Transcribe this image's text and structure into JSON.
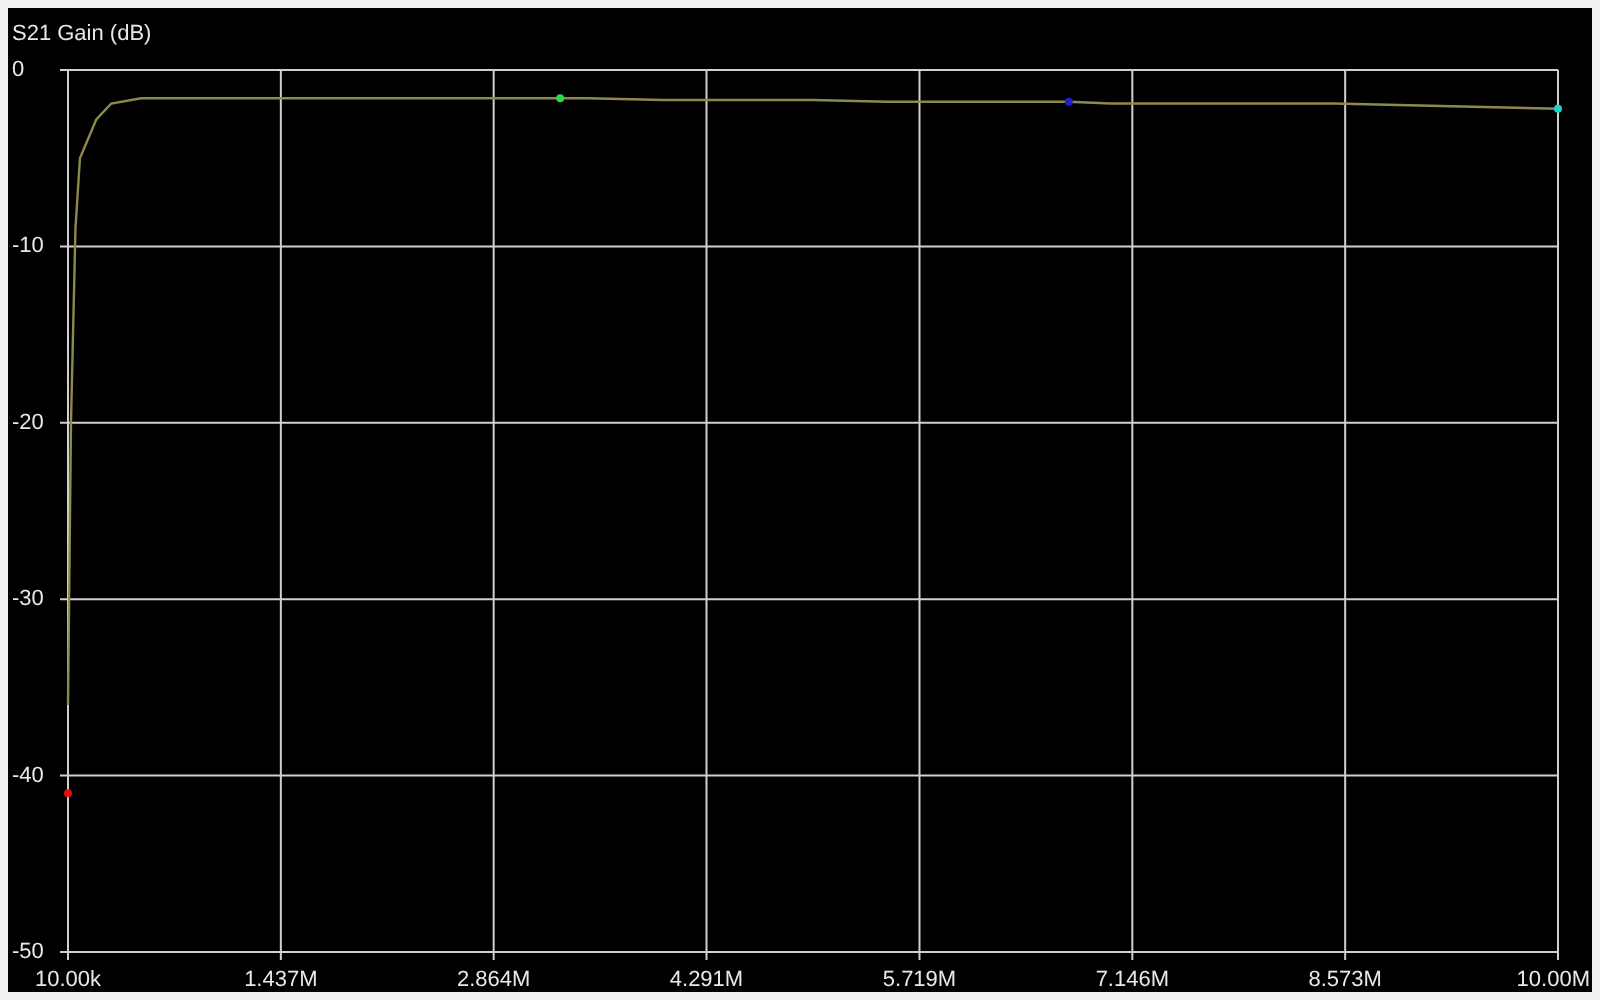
{
  "chart_data": {
    "type": "line",
    "title": "S21 Gain (dB)",
    "grid": true,
    "x": [
      10000,
      30000,
      60000,
      90000,
      200000,
      300000,
      500000,
      1000000,
      1500000,
      2000000,
      2500000,
      3000000,
      3310000,
      3500000,
      4000000,
      4500000,
      5000000,
      5500000,
      6000000,
      6500000,
      6720000,
      7000000,
      7500000,
      8000000,
      8500000,
      9000000,
      9500000,
      10000000
    ],
    "series": [
      {
        "color": "#8f8a4a",
        "values": [
          -36,
          -20,
          -9,
          -5,
          -2.8,
          -1.9,
          -1.6,
          -1.6,
          -1.6,
          -1.6,
          -1.6,
          -1.6,
          -1.6,
          -1.6,
          -1.7,
          -1.7,
          -1.7,
          -1.8,
          -1.8,
          -1.8,
          -1.8,
          -1.9,
          -1.9,
          -1.9,
          -1.9,
          -2,
          -2.1,
          -2.2
        ]
      },
      {
        "marker": "dot",
        "color": "#e01010",
        "values": [
          -41,
          null,
          null,
          null,
          null,
          null,
          null,
          null,
          null,
          null,
          null,
          null,
          null,
          null,
          null,
          null,
          null,
          null,
          null,
          null,
          null,
          null,
          null,
          null,
          null,
          null,
          null,
          null
        ]
      },
      {
        "marker": "dot",
        "color": "#20e040",
        "values": [
          null,
          null,
          null,
          null,
          null,
          null,
          null,
          null,
          null,
          null,
          null,
          null,
          -1.6,
          null,
          null,
          null,
          null,
          null,
          null,
          null,
          null,
          null,
          null,
          null,
          null,
          null,
          null,
          null
        ]
      },
      {
        "marker": "dot",
        "color": "#2020d0",
        "values": [
          null,
          null,
          null,
          null,
          null,
          null,
          null,
          null,
          null,
          null,
          null,
          null,
          null,
          null,
          null,
          null,
          null,
          null,
          null,
          null,
          -1.8,
          null,
          null,
          null,
          null,
          null,
          null,
          null
        ]
      },
      {
        "marker": "dot",
        "color": "#20d0d0",
        "values": [
          null,
          null,
          null,
          null,
          null,
          null,
          null,
          null,
          null,
          null,
          null,
          null,
          null,
          null,
          null,
          null,
          null,
          null,
          null,
          null,
          null,
          null,
          null,
          null,
          null,
          null,
          null,
          -2.2
        ]
      }
    ],
    "xlim": [
      10000,
      10000000
    ],
    "ylim": [
      -50,
      0
    ],
    "xticks": [
      {
        "value": 10000,
        "label": "10.00k"
      },
      {
        "value": 1437000,
        "label": "1.437M"
      },
      {
        "value": 2864000,
        "label": "2.864M"
      },
      {
        "value": 4291000,
        "label": "4.291M"
      },
      {
        "value": 5719000,
        "label": "5.719M"
      },
      {
        "value": 7146000,
        "label": "7.146M"
      },
      {
        "value": 8573000,
        "label": "8.573M"
      },
      {
        "value": 10000000,
        "label": "10.00M"
      }
    ],
    "yticks": [
      0,
      -10,
      -20,
      -30,
      -40,
      -50
    ]
  }
}
